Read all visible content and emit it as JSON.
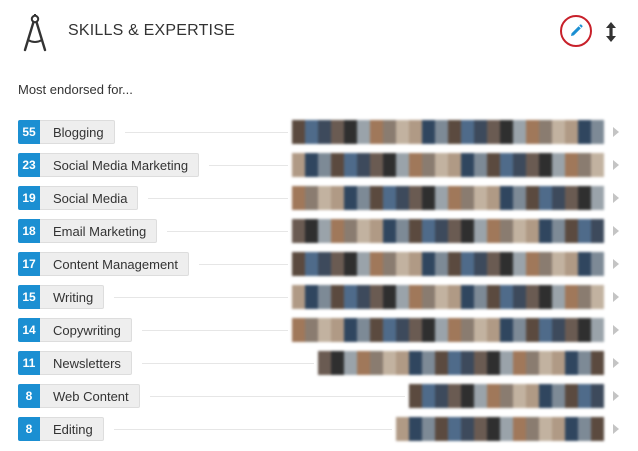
{
  "header": {
    "title": "SKILLS & EXPERTISE",
    "icon": "compass-drafting-icon",
    "edit_icon": "pencil-icon",
    "reorder_icon": "up-down-arrows-icon"
  },
  "subheading": "Most endorsed for...",
  "colors": {
    "count_badge": "#1b8fd2",
    "edit_highlight": "#c8202a",
    "pill_background": "#eeeeee",
    "pencil": "#1b8fd2"
  },
  "skills": [
    {
      "count": "55",
      "name": "Blogging",
      "endorser_thumbnails": 24
    },
    {
      "count": "23",
      "name": "Social Media Marketing",
      "endorser_thumbnails": 24
    },
    {
      "count": "19",
      "name": "Social Media",
      "endorser_thumbnails": 24
    },
    {
      "count": "18",
      "name": "Email Marketing",
      "endorser_thumbnails": 24
    },
    {
      "count": "17",
      "name": "Content Management",
      "endorser_thumbnails": 24
    },
    {
      "count": "15",
      "name": "Writing",
      "endorser_thumbnails": 24
    },
    {
      "count": "14",
      "name": "Copywriting",
      "endorser_thumbnails": 24
    },
    {
      "count": "11",
      "name": "Newsletters",
      "endorser_thumbnails": 22
    },
    {
      "count": "8",
      "name": "Web Content",
      "endorser_thumbnails": 15
    },
    {
      "count": "8",
      "name": "Editing",
      "endorser_thumbnails": 16
    }
  ]
}
